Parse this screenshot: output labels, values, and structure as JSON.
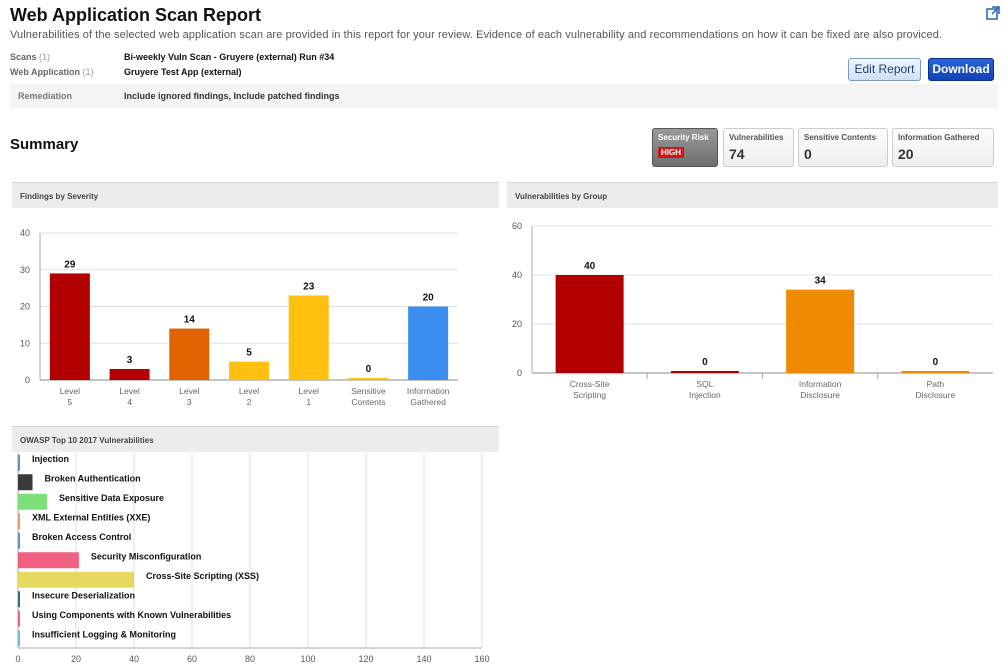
{
  "page": {
    "title": "Web Application Scan Report",
    "subtitle": "Vulnerabilities of the selected web application scan are provided in this report for your review. Evidence of each vulnerability and recommendations on how it can be fixed are also proviced."
  },
  "meta": {
    "scans_label": "Scans",
    "scans_count": "(1)",
    "scans_value": "Bi-weekly Vuln Scan - Gruyere (external) Run #34",
    "webapp_label": "Web Application",
    "webapp_count": "(1)",
    "webapp_value": "Gruyere Test App (external)",
    "remediation_label": "Remediation",
    "remediation_value": "Include ignored findings, Include patched findings"
  },
  "buttons": {
    "edit": "Edit Report",
    "download": "Download"
  },
  "summary": {
    "title": "Summary",
    "security_risk_label": "Security Risk",
    "security_risk_value": "HIGH",
    "vulnerabilities_label": "Vulnerabilities",
    "vulnerabilities_value": "74",
    "sensitive_label": "Sensitive Contents",
    "sensitive_value": "0",
    "info_label": "Information Gathered",
    "info_value": "20"
  },
  "chart_data": [
    {
      "type": "bar",
      "title": "Findings by Severity",
      "categories": [
        [
          "Level",
          "5"
        ],
        [
          "Level",
          "4"
        ],
        [
          "Level",
          "3"
        ],
        [
          "Level",
          "2"
        ],
        [
          "Level",
          "1"
        ],
        [
          "Sensitive",
          "Contents"
        ],
        [
          "Information",
          "Gathered"
        ]
      ],
      "values": [
        29,
        3,
        14,
        5,
        23,
        0,
        20
      ],
      "colors": [
        "#b20000",
        "#b20000",
        "#e06200",
        "#ffc010",
        "#ffc010",
        "#ffc010",
        "#3b8ef0"
      ],
      "ylim": [
        0,
        40
      ],
      "yticks": [
        0,
        10,
        20,
        30,
        40
      ],
      "grid": true
    },
    {
      "type": "bar",
      "title": "Vulnerabilities by Group",
      "categories": [
        [
          "Cross-Site",
          "Scripting"
        ],
        [
          "SQL",
          "Injection"
        ],
        [
          "Information",
          "Disclosure"
        ],
        [
          "Path",
          "Disclosure"
        ]
      ],
      "values": [
        40,
        0,
        34,
        0
      ],
      "colors": [
        "#b20000",
        "#b20000",
        "#f08a00",
        "#f08a00"
      ],
      "ylim": [
        0,
        60
      ],
      "yticks": [
        0,
        20,
        40,
        60
      ],
      "grid": true
    },
    {
      "type": "bar",
      "orientation": "horizontal",
      "title": "OWASP Top 10 2017 Vulnerabilities",
      "categories": [
        "Injection",
        "Broken Authentication",
        "Sensitive Data Exposure",
        "XML External Entities (XXE)",
        "Broken Access Control",
        "Security Misconfiguration",
        "Cross-Site Scripting (XSS)",
        "Insecure Deserialization",
        "Using Components with Known Vulnerabilities",
        "Insufficient Logging & Monitoring"
      ],
      "values": [
        0,
        5,
        10,
        0,
        0,
        21,
        40,
        0,
        0,
        0
      ],
      "colors": [
        "#6a8fb5",
        "#3a3a3a",
        "#7ee07a",
        "#e0a070",
        "#6a8fb5",
        "#f06080",
        "#e6d860",
        "#3a6a8a",
        "#f06080",
        "#70c0c8"
      ],
      "xlim": [
        0,
        160
      ],
      "xticks": [
        0,
        20,
        40,
        60,
        80,
        100,
        120,
        140,
        160
      ],
      "grid": true
    }
  ]
}
